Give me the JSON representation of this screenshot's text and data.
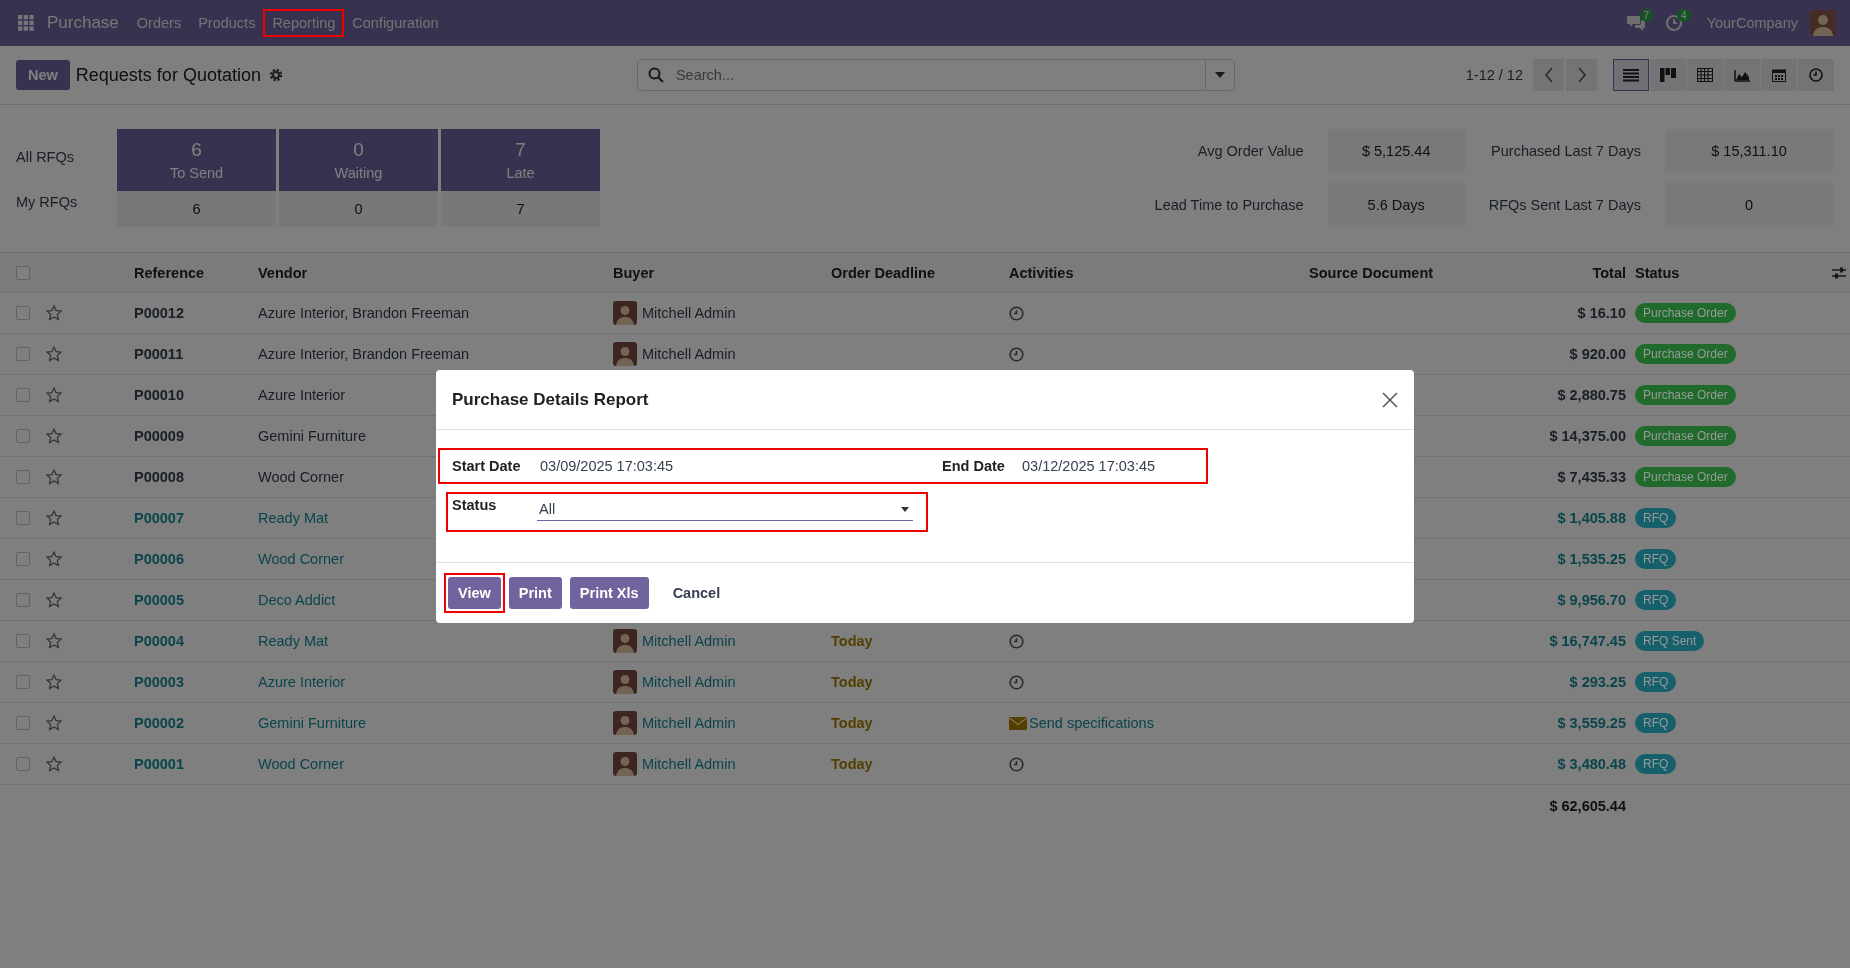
{
  "navbar": {
    "app": "Purchase",
    "menu": [
      {
        "label": "Orders",
        "highlighted": false
      },
      {
        "label": "Products",
        "highlighted": false
      },
      {
        "label": "Reporting",
        "highlighted": true
      },
      {
        "label": "Configuration",
        "highlighted": false
      }
    ],
    "messages_count": "7",
    "activities_count": "4",
    "company": "YourCompany"
  },
  "control_panel": {
    "new_button": "New",
    "title": "Requests for Quotation",
    "search": {
      "placeholder": "Search..."
    },
    "pager": "1-12 / 12",
    "views": [
      {
        "kind": "list",
        "selected": true
      },
      {
        "kind": "kanban",
        "selected": false
      },
      {
        "kind": "pivot",
        "selected": false
      },
      {
        "kind": "graph",
        "selected": false
      },
      {
        "kind": "calendar",
        "selected": false
      },
      {
        "kind": "activity",
        "selected": false
      }
    ]
  },
  "dashboard": {
    "row_labels": [
      "All RFQs",
      "My RFQs"
    ],
    "tiles": [
      {
        "count": "6",
        "label": "To Send",
        "mine": "6"
      },
      {
        "count": "0",
        "label": "Waiting",
        "mine": "0"
      },
      {
        "count": "7",
        "label": "Late",
        "mine": "7"
      }
    ],
    "stats": [
      {
        "label": "Avg Order Value",
        "value": "$ 5,125.44"
      },
      {
        "label": "Purchased Last 7 Days",
        "value": "$ 15,311.10"
      },
      {
        "label": "Lead Time to Purchase",
        "value": "5.6 Days"
      },
      {
        "label": "RFQs Sent Last 7 Days",
        "value": "0"
      }
    ]
  },
  "table": {
    "all_selected": false,
    "columns": [
      "Reference",
      "Vendor",
      "Buyer",
      "Order Deadline",
      "Activities",
      "Source Document",
      "Total",
      "Status"
    ],
    "rows": [
      {
        "kind": "order",
        "selected": false,
        "starred": false,
        "reference": "P00012",
        "vendor": "Azure Interior, Brandon Freeman",
        "buyer": "Mitchell Admin",
        "activity": {
          "kind": "clock"
        },
        "total": "$ 16.10",
        "status": {
          "label": "Purchase Order",
          "color": "#206b2c"
        }
      },
      {
        "kind": "order",
        "selected": false,
        "starred": false,
        "reference": "P00011",
        "vendor": "Azure Interior, Brandon Freeman",
        "buyer": "Mitchell Admin",
        "activity": {
          "kind": "clock"
        },
        "total": "$ 920.00",
        "status": {
          "label": "Purchase Order",
          "color": "#206b2c"
        }
      },
      {
        "kind": "order",
        "selected": false,
        "starred": false,
        "reference": "P00010",
        "vendor": "Azure Interior",
        "total": "$ 2,880.75",
        "status": {
          "label": "Purchase Order",
          "color": "#206b2c"
        }
      },
      {
        "kind": "order",
        "selected": false,
        "starred": false,
        "reference": "P00009",
        "vendor": "Gemini Furniture",
        "total": "$ 14,375.00",
        "status": {
          "label": "Purchase Order",
          "color": "#206b2c"
        }
      },
      {
        "kind": "order",
        "selected": false,
        "starred": false,
        "reference": "P00008",
        "vendor": "Wood Corner",
        "total": "$ 7,435.33",
        "status": {
          "label": "Purchase Order",
          "color": "#206b2c"
        }
      },
      {
        "kind": "rfq",
        "selected": false,
        "starred": false,
        "reference": "P00007",
        "vendor": "Ready Mat",
        "total": "$ 1,405.88",
        "status": {
          "label": "RFQ",
          "color": "#15606b"
        }
      },
      {
        "kind": "rfq",
        "selected": false,
        "starred": false,
        "reference": "P00006",
        "vendor": "Wood Corner",
        "total": "$ 1,535.25",
        "status": {
          "label": "RFQ",
          "color": "#15606b"
        }
      },
      {
        "kind": "rfq",
        "selected": false,
        "starred": false,
        "reference": "P00005",
        "vendor": "Deco Addict",
        "total": "$ 9,956.70",
        "status": {
          "label": "RFQ",
          "color": "#15606b"
        }
      },
      {
        "kind": "rfq",
        "selected": false,
        "starred": false,
        "reference": "P00004",
        "vendor": "Ready Mat",
        "buyer": "Mitchell Admin",
        "deadline": "Today",
        "activity": {
          "kind": "clock"
        },
        "total": "$ 16,747.45",
        "status": {
          "label": "RFQ Sent",
          "color": "#15606b"
        }
      },
      {
        "kind": "rfq",
        "selected": false,
        "starred": false,
        "reference": "P00003",
        "vendor": "Azure Interior",
        "buyer": "Mitchell Admin",
        "deadline": "Today",
        "activity": {
          "kind": "clock"
        },
        "total": "$ 293.25",
        "status": {
          "label": "RFQ",
          "color": "#15606b"
        }
      },
      {
        "kind": "rfq",
        "selected": false,
        "starred": false,
        "reference": "P00002",
        "vendor": "Gemini Furniture",
        "buyer": "Mitchell Admin",
        "deadline": "Today",
        "activity": {
          "kind": "mail",
          "label": "Send specifications"
        },
        "total": "$ 3,559.25",
        "status": {
          "label": "RFQ",
          "color": "#15606b"
        }
      },
      {
        "kind": "rfq",
        "selected": false,
        "starred": false,
        "reference": "P00001",
        "vendor": "Wood Corner",
        "buyer": "Mitchell Admin",
        "deadline": "Today",
        "activity": {
          "kind": "clock"
        },
        "total": "$ 3,480.48",
        "status": {
          "label": "RFQ",
          "color": "#15606b"
        }
      }
    ],
    "total": "$ 62,605.44"
  },
  "dialog": {
    "title": "Purchase Details Report",
    "dates_highlighted": true,
    "date_fields": [
      {
        "label": "Start Date",
        "value": "03/09/2025 17:03:45"
      },
      {
        "label": "End Date",
        "value": "03/12/2025 17:03:45"
      }
    ],
    "status_field": {
      "label": "Status",
      "value": "All",
      "highlighted": true
    },
    "buttons": [
      {
        "kind": "primary",
        "label": "View",
        "highlighted": true
      },
      {
        "kind": "primary",
        "label": "Print",
        "highlighted": false
      },
      {
        "kind": "primary",
        "label": "Print Xls",
        "highlighted": false
      },
      {
        "kind": "link",
        "label": "Cancel",
        "highlighted": false
      }
    ]
  }
}
